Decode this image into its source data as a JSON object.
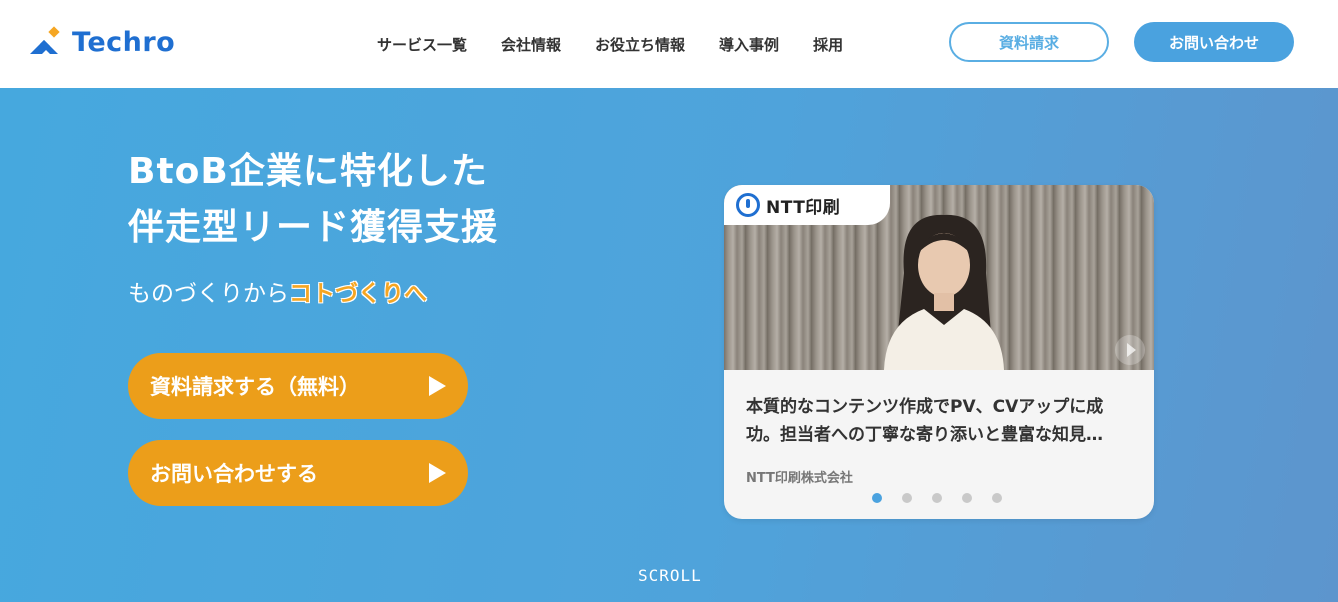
{
  "header": {
    "logo_text": "Techro",
    "nav": [
      "サービス一覧",
      "会社情報",
      "お役立ち情報",
      "導入事例",
      "採用"
    ],
    "doc_button": "資料請求",
    "contact_button": "お問い合わせ"
  },
  "hero": {
    "title_line1": "BtoB企業に特化した",
    "title_line2": "伴走型リード獲得支援",
    "sub_prefix": "ものづくりから",
    "sub_accent": "コトづくりへ",
    "cta_doc": "資料請求する（無料）",
    "cta_contact": "お問い合わせする",
    "scroll": "SCROLL"
  },
  "card": {
    "brand": "NTT印刷",
    "text": "本質的なコンテンツ作成でPV、CVアップに成功。担当者への丁寧な寄り添いと豊富な知見…",
    "company": "NTT印刷株式会社",
    "dots": 5,
    "active_dot": 0
  },
  "colors": {
    "brand_blue": "#1f6fd1",
    "light_blue": "#4aa2df",
    "cta_orange": "#ec9e1a",
    "accent_orange": "#f5a623"
  },
  "icons": [
    "techro-logo-icon",
    "play-icon",
    "ntt-logo-icon",
    "next-arrow-icon"
  ]
}
